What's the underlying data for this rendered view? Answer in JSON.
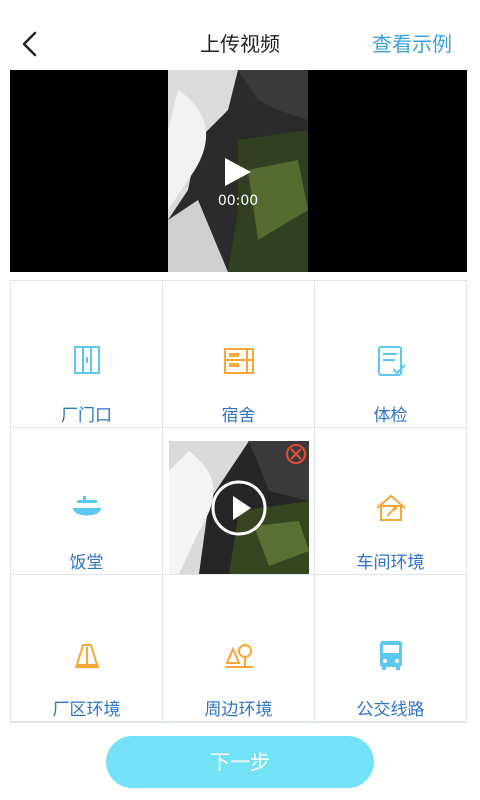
{
  "header": {
    "back_icon": "chevron-left-icon",
    "title": "上传视频",
    "example_link": "查看示例"
  },
  "video": {
    "time": "00:00",
    "play_icon": "play-icon"
  },
  "grid": {
    "items": [
      {
        "label": "厂门口",
        "icon": "door-icon",
        "color": "#5cc7ef"
      },
      {
        "label": "宿舍",
        "icon": "bunk-bed-icon",
        "color": "#f7a735"
      },
      {
        "label": "体检",
        "icon": "clipboard-check-icon",
        "color": "#5cc7ef"
      },
      {
        "label": "饭堂",
        "icon": "bowl-icon",
        "color": "#5cc7ef"
      },
      {
        "label": "",
        "icon": "video-thumbnail",
        "color": ""
      },
      {
        "label": "车间环境",
        "icon": "tool-house-icon",
        "color": "#f7a735"
      },
      {
        "label": "厂区环境",
        "icon": "hill-icon",
        "color": "#f7a735"
      },
      {
        "label": "周边环境",
        "icon": "trees-icon",
        "color": "#f7a735"
      },
      {
        "label": "公交线路",
        "icon": "bus-icon",
        "color": "#5cc7ef"
      }
    ],
    "delete_icon": "delete-icon"
  },
  "footer": {
    "next_label": "下一步"
  }
}
